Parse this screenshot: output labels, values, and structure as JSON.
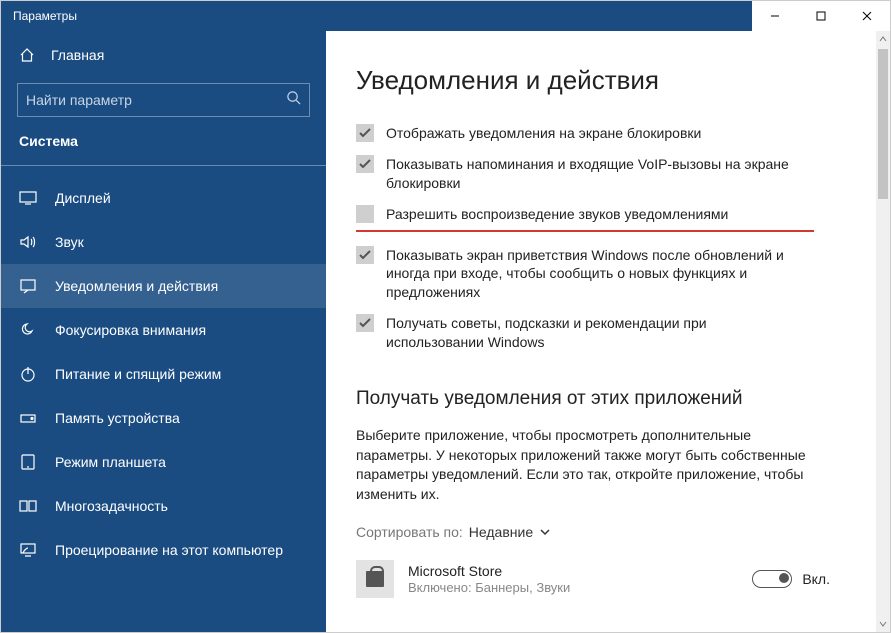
{
  "window": {
    "title": "Параметры"
  },
  "sidebar": {
    "home_label": "Главная",
    "search_placeholder": "Найти параметр",
    "section": "Система",
    "items": [
      {
        "icon": "display-icon",
        "label": "Дисплей"
      },
      {
        "icon": "sound-icon",
        "label": "Звук"
      },
      {
        "icon": "notifications-icon",
        "label": "Уведомления и действия"
      },
      {
        "icon": "focus-icon",
        "label": "Фокусировка внимания"
      },
      {
        "icon": "power-icon",
        "label": "Питание и спящий режим"
      },
      {
        "icon": "storage-icon",
        "label": "Память устройства"
      },
      {
        "icon": "tablet-icon",
        "label": "Режим планшета"
      },
      {
        "icon": "multitask-icon",
        "label": "Многозадачность"
      },
      {
        "icon": "projecting-icon",
        "label": "Проецирование на этот компьютер"
      }
    ]
  },
  "main": {
    "heading": "Уведомления и действия",
    "checks": [
      {
        "checked": true,
        "label": "Отображать уведомления на экране блокировки"
      },
      {
        "checked": true,
        "label": "Показывать напоминания и входящие VoIP-вызовы на экране блокировки"
      },
      {
        "checked": false,
        "label": "Разрешить  воспроизведение звуков уведомлениями",
        "highlighted": true
      },
      {
        "checked": true,
        "label": "Показывать экран приветствия Windows после обновлений и иногда при входе, чтобы сообщить о новых функциях и предложениях"
      },
      {
        "checked": true,
        "label": "Получать советы, подсказки и рекомендации при использовании Windows"
      }
    ],
    "apps_section": {
      "heading": "Получать уведомления от этих приложений",
      "description": "Выберите приложение, чтобы просмотреть дополнительные параметры. У некоторых приложений также могут быть собственные параметры уведомлений. Если это так, откройте приложение, чтобы изменить их.",
      "sort_label": "Сортировать по:",
      "sort_value": "Недавние",
      "apps": [
        {
          "name": "Microsoft Store",
          "sub": "Включено: Баннеры, Звуки",
          "toggle_on": true,
          "toggle_label": "Вкл."
        }
      ]
    }
  }
}
